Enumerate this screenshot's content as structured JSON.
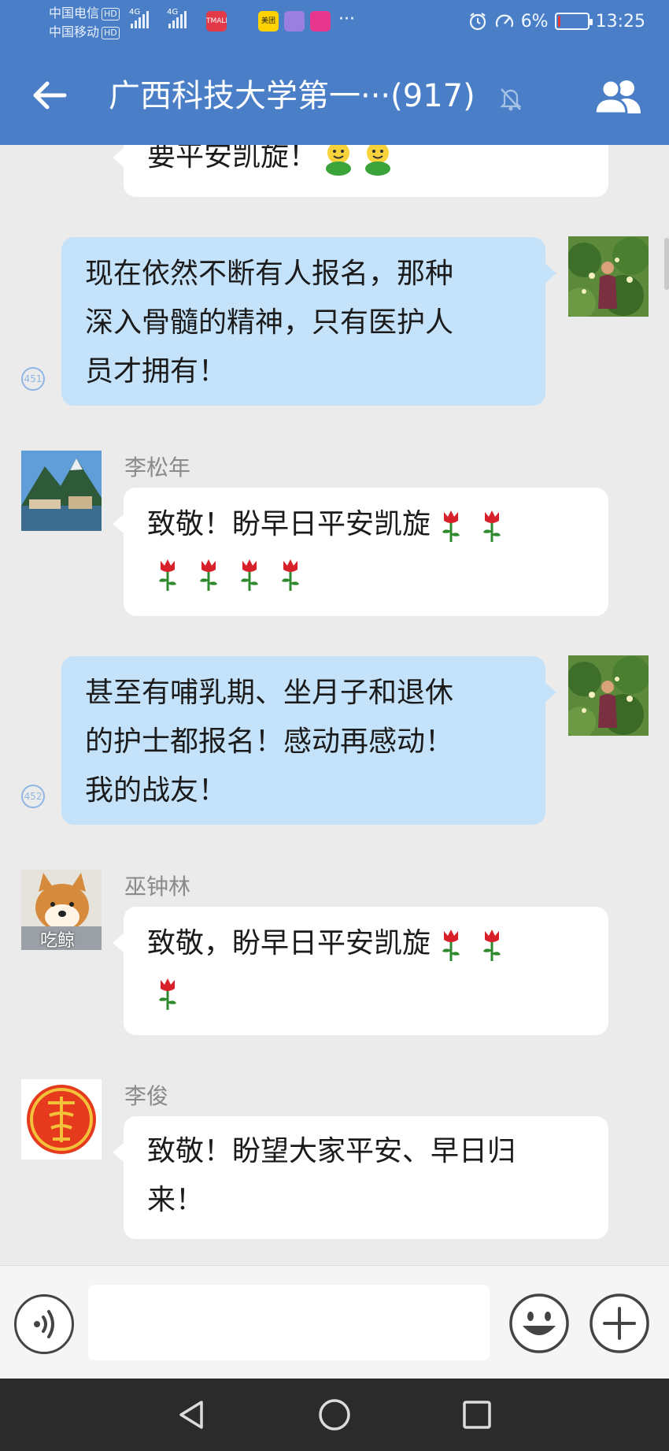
{
  "status_bar": {
    "carrier_1": "中国电信",
    "carrier_2": "中国移动",
    "hd_badge": "HD",
    "network_1": "4G",
    "network_2": "4G",
    "more": "···",
    "battery_percent": "6%",
    "battery_level": 0.06,
    "time": "13:25",
    "app_icons": [
      {
        "name": "shopping-app-icon",
        "color": "#e23a48",
        "text": "TMALL"
      },
      {
        "name": "qq-app-icon",
        "color": "#4a7fc8",
        "text": ""
      },
      {
        "name": "meituan-app-icon",
        "color": "#ffd200",
        "text": "美团"
      },
      {
        "name": "gallery-app-icon",
        "color": "#9a7fe0",
        "text": ""
      },
      {
        "name": "promo-app-icon",
        "color": "#e8368f",
        "text": ""
      }
    ]
  },
  "header": {
    "title": "广西科技大学第一···(917)"
  },
  "chat": {
    "messages": [
      {
        "id": "m0",
        "side": "in",
        "sender": "",
        "text": "要平安凯旋！"
      },
      {
        "id": "m1",
        "side": "out",
        "lines": [
          "现在依然不断有人报名，那种",
          "深入骨髓的精神，只有医护人",
          "员才拥有！"
        ],
        "read_count": "451"
      },
      {
        "id": "m2",
        "side": "in",
        "sender": "李松年",
        "line_1": "致敬！盼早日平安凯旋"
      },
      {
        "id": "m3",
        "side": "out",
        "lines": [
          "甚至有哺乳期、坐月子和退休",
          "的护士都报名！感动再感动！",
          "我的战友！"
        ],
        "read_count": "452"
      },
      {
        "id": "m4",
        "side": "in",
        "sender": "巫钟林",
        "line_1": "致敬，盼早日平安凯旋",
        "avatar_caption": "吃鲸"
      },
      {
        "id": "m5",
        "side": "in",
        "sender": "李俊",
        "lines": [
          "致敬！盼望大家平安、早日归",
          "来！"
        ]
      }
    ]
  },
  "input_bar": {
    "placeholder": ""
  },
  "colors": {
    "header_bg": "#4a7fc8",
    "chat_bg": "#ebebeb",
    "out_bubble": "#c5e2fb",
    "in_bubble": "#ffffff"
  }
}
